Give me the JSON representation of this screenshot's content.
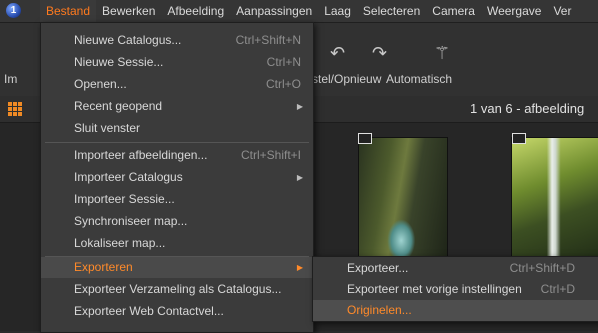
{
  "menubar": {
    "logo_text": "1",
    "items": [
      "Bestand",
      "Bewerken",
      "Afbeelding",
      "Aanpassingen",
      "Laag",
      "Selecteren",
      "Camera",
      "Weergave",
      "Ver"
    ]
  },
  "toolbar": {
    "import_label_partial": "Im",
    "undo_redo_label": "stel/Opnieuw",
    "auto_label": "Automatisch",
    "icons": [
      "undo-icon",
      "redo-icon",
      "magic-wand-icon"
    ]
  },
  "browser": {
    "count_text": "1 van 6 - afbeelding"
  },
  "file_menu": {
    "items": [
      {
        "label": "Nieuwe Catalogus...",
        "shortcut": "Ctrl+Shift+N"
      },
      {
        "label": "Nieuwe Sessie...",
        "shortcut": "Ctrl+N"
      },
      {
        "label": "Openen...",
        "shortcut": "Ctrl+O"
      },
      {
        "label": "Recent geopend",
        "shortcut": "",
        "submenu": true
      },
      {
        "label": "Sluit venster",
        "shortcut": ""
      },
      {
        "label": "Importeer afbeeldingen...",
        "shortcut": "Ctrl+Shift+I"
      },
      {
        "label": "Importeer Catalogus",
        "shortcut": "",
        "submenu": true
      },
      {
        "label": "Importeer Sessie...",
        "shortcut": ""
      },
      {
        "label": "Synchroniseer map...",
        "shortcut": ""
      },
      {
        "label": "Lokaliseer map...",
        "shortcut": ""
      },
      {
        "label": "Exporteren",
        "shortcut": "",
        "submenu": true,
        "highlighted": true
      },
      {
        "label": "Exporteer Verzameling als Catalogus...",
        "shortcut": ""
      },
      {
        "label": "Exporteer Web Contactvel...",
        "shortcut": ""
      }
    ]
  },
  "export_submenu": {
    "items": [
      {
        "label": "Exporteer...",
        "shortcut": "Ctrl+Shift+D"
      },
      {
        "label": "Exporteer met vorige instellingen",
        "shortcut": "Ctrl+D"
      },
      {
        "label": "Originelen...",
        "shortcut": "",
        "highlighted": true
      }
    ]
  },
  "colors": {
    "accent": "#ff8a2a",
    "menu_bg": "#3b3b3b",
    "app_bg": "#2b2b2b"
  }
}
